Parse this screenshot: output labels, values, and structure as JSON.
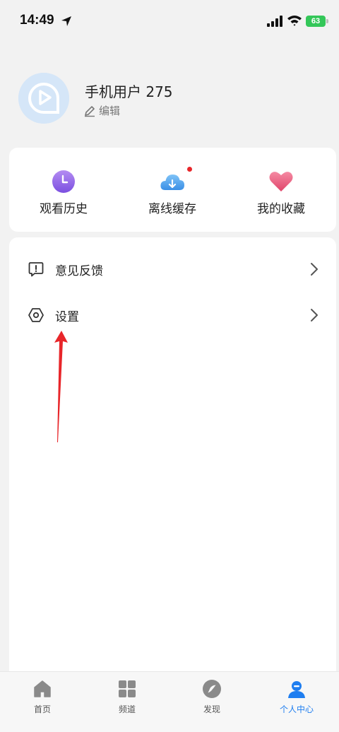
{
  "status_bar": {
    "time": "14:49",
    "battery": "63"
  },
  "profile": {
    "username": "手机用户 275",
    "edit_label": "编辑"
  },
  "shortcuts": [
    {
      "label": "观看历史",
      "icon": "clock-icon"
    },
    {
      "label": "离线缓存",
      "icon": "cloud-download-icon",
      "badge": true
    },
    {
      "label": "我的收藏",
      "icon": "heart-icon"
    }
  ],
  "menu": [
    {
      "label": "意见反馈",
      "icon": "feedback-icon"
    },
    {
      "label": "设置",
      "icon": "settings-icon"
    }
  ],
  "tabs": [
    {
      "label": "首页",
      "icon": "home-icon",
      "active": false
    },
    {
      "label": "频道",
      "icon": "grid-icon",
      "active": false
    },
    {
      "label": "发现",
      "icon": "compass-icon",
      "active": false
    },
    {
      "label": "个人中心",
      "icon": "user-icon",
      "active": true
    }
  ],
  "colors": {
    "accent": "#1f7ef0",
    "annotation": "#e8262a",
    "battery": "#34c759"
  }
}
